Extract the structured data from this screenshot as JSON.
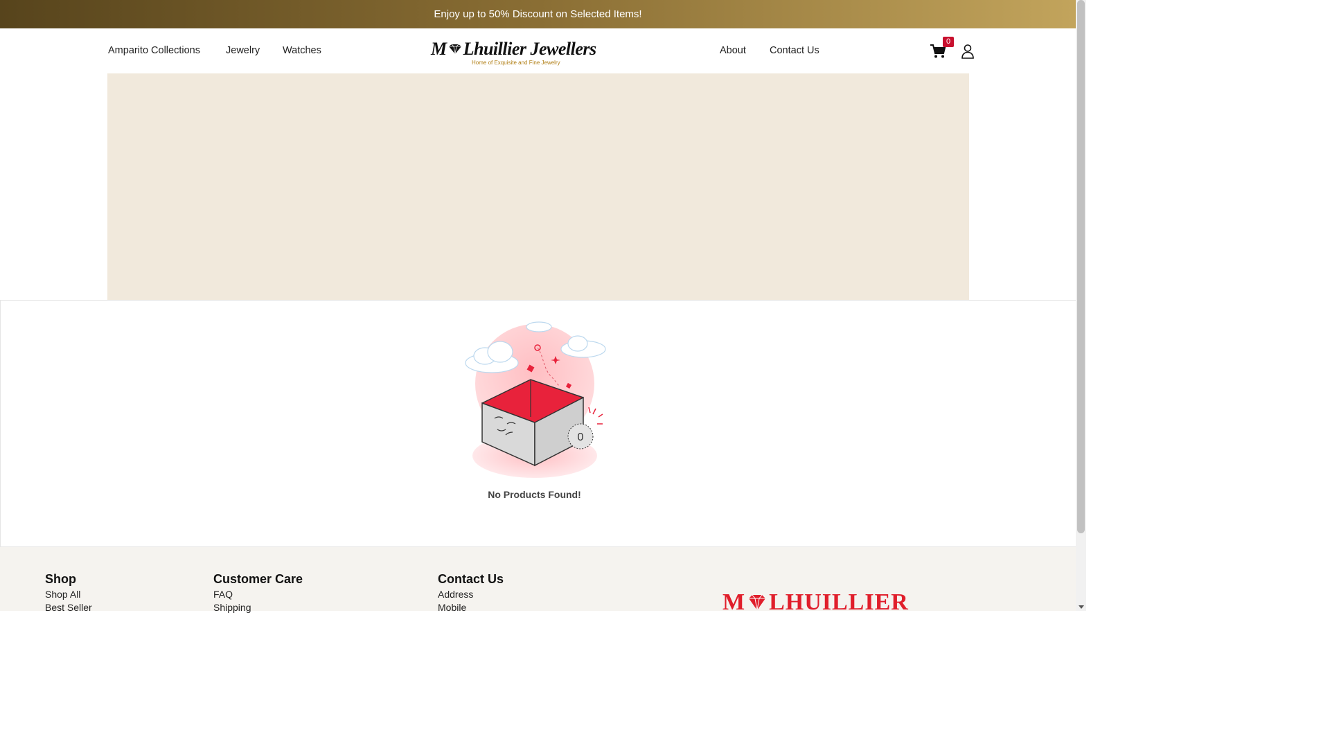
{
  "promo": {
    "text": "Enjoy up to 50% Discount on Selected Items!"
  },
  "nav": {
    "left": [
      "Amparito Collections",
      "Jewelry",
      "Watches"
    ],
    "right": [
      "About",
      "Contact Us"
    ],
    "cart_count": "0",
    "icons": {
      "cart": "cart-icon",
      "user": "user-icon"
    }
  },
  "logo": {
    "title_start": "M",
    "title_end": "Lhuillier Jewellers",
    "tagline": "Home of Exquisite and Fine Jewelry"
  },
  "empty_state": {
    "message": "No Products Found!",
    "badge": "0"
  },
  "footer": {
    "shop": {
      "heading": "Shop",
      "links": [
        "Shop All",
        "Best Seller"
      ]
    },
    "customer_care": {
      "heading": "Customer Care",
      "links": [
        "FAQ",
        "Shipping"
      ]
    },
    "contact": {
      "heading": "Contact Us",
      "links": [
        "Address",
        "Mobile"
      ]
    },
    "brand_start": "M",
    "brand_end": "LHUILLIER"
  },
  "colors": {
    "accent_red": "#e01e2b",
    "gold": "#b07d12",
    "hero_bg": "#f1e9dc"
  }
}
